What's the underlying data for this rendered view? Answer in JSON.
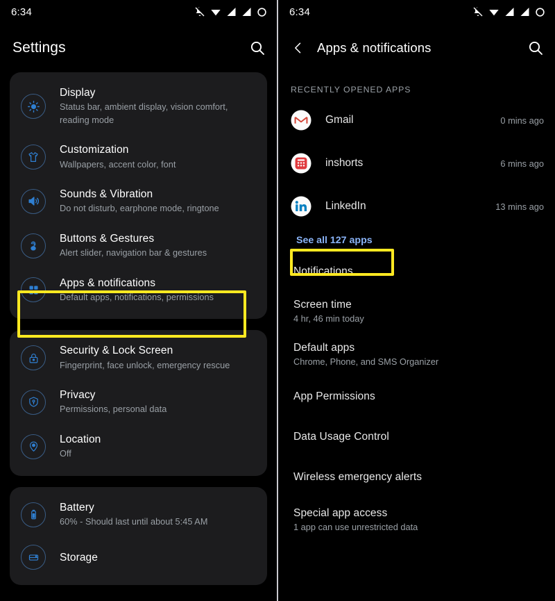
{
  "colors": {
    "highlight": "#ffe921",
    "accent_blue": "#8ab4f8",
    "icon_blue": "#3d7ebb",
    "card_bg": "#1c1c1e",
    "screen_bg": "#000000",
    "subtext": "#9aa0a6"
  },
  "left": {
    "status": {
      "time": "6:34",
      "icons": [
        "bell-muted-icon",
        "wifi-icon",
        "signal-icon",
        "signal-x-icon",
        "battery-circle-icon"
      ]
    },
    "appbar": {
      "title": "Settings",
      "search_icon": "search-icon"
    },
    "groups": [
      {
        "items": [
          {
            "icon": "brightness-icon",
            "title": "Display",
            "subtitle": "Status bar, ambient display, vision comfort, reading mode"
          },
          {
            "icon": "tshirt-icon",
            "title": "Customization",
            "subtitle": "Wallpapers, accent color, font"
          },
          {
            "icon": "volume-icon",
            "title": "Sounds & Vibration",
            "subtitle": "Do not disturb, earphone mode, ringtone"
          },
          {
            "icon": "fingerprint-touch-icon",
            "title": "Buttons & Gestures",
            "subtitle": "Alert slider, navigation bar & gestures"
          },
          {
            "icon": "apps-grid-icon",
            "title": "Apps & notifications",
            "subtitle": "Default apps, notifications, permissions",
            "highlighted": true
          }
        ]
      },
      {
        "items": [
          {
            "icon": "lock-icon",
            "title": "Security & Lock Screen",
            "subtitle": "Fingerprint, face unlock, emergency rescue"
          },
          {
            "icon": "shield-key-icon",
            "title": "Privacy",
            "subtitle": "Permissions, personal data"
          },
          {
            "icon": "location-pin-icon",
            "title": "Location",
            "subtitle": "Off"
          }
        ]
      },
      {
        "items": [
          {
            "icon": "battery-icon",
            "title": "Battery",
            "subtitle": "60% - Should last until about 5:45 AM"
          },
          {
            "icon": "storage-icon",
            "title": "Storage",
            "subtitle": ""
          }
        ]
      }
    ]
  },
  "right": {
    "status": {
      "time": "6:34",
      "icons": [
        "bell-muted-icon",
        "wifi-icon",
        "signal-icon",
        "signal-x-icon",
        "battery-circle-icon"
      ]
    },
    "appbar": {
      "back_icon": "back-chevron-icon",
      "title": "Apps & notifications",
      "search_icon": "search-icon"
    },
    "section_label": "RECENTLY OPENED APPS",
    "recent_apps": [
      {
        "icon": "gmail-icon",
        "name": "Gmail",
        "time": "0 mins ago"
      },
      {
        "icon": "inshorts-icon",
        "name": "inshorts",
        "time": "6 mins ago"
      },
      {
        "icon": "linkedin-icon",
        "name": "LinkedIn",
        "time": "13 mins ago"
      }
    ],
    "see_all": "See all 127 apps",
    "items": [
      {
        "title": "Notifications",
        "subtitle": ""
      },
      {
        "title": "Screen time",
        "subtitle": "4 hr, 46 min today"
      },
      {
        "title": "Default apps",
        "subtitle": "Chrome, Phone, and SMS Organizer"
      },
      {
        "title": "App Permissions",
        "subtitle": ""
      },
      {
        "title": "Data Usage Control",
        "subtitle": ""
      },
      {
        "title": "Wireless emergency alerts",
        "subtitle": ""
      },
      {
        "title": "Special app access",
        "subtitle": "1 app can use unrestricted data"
      }
    ]
  }
}
